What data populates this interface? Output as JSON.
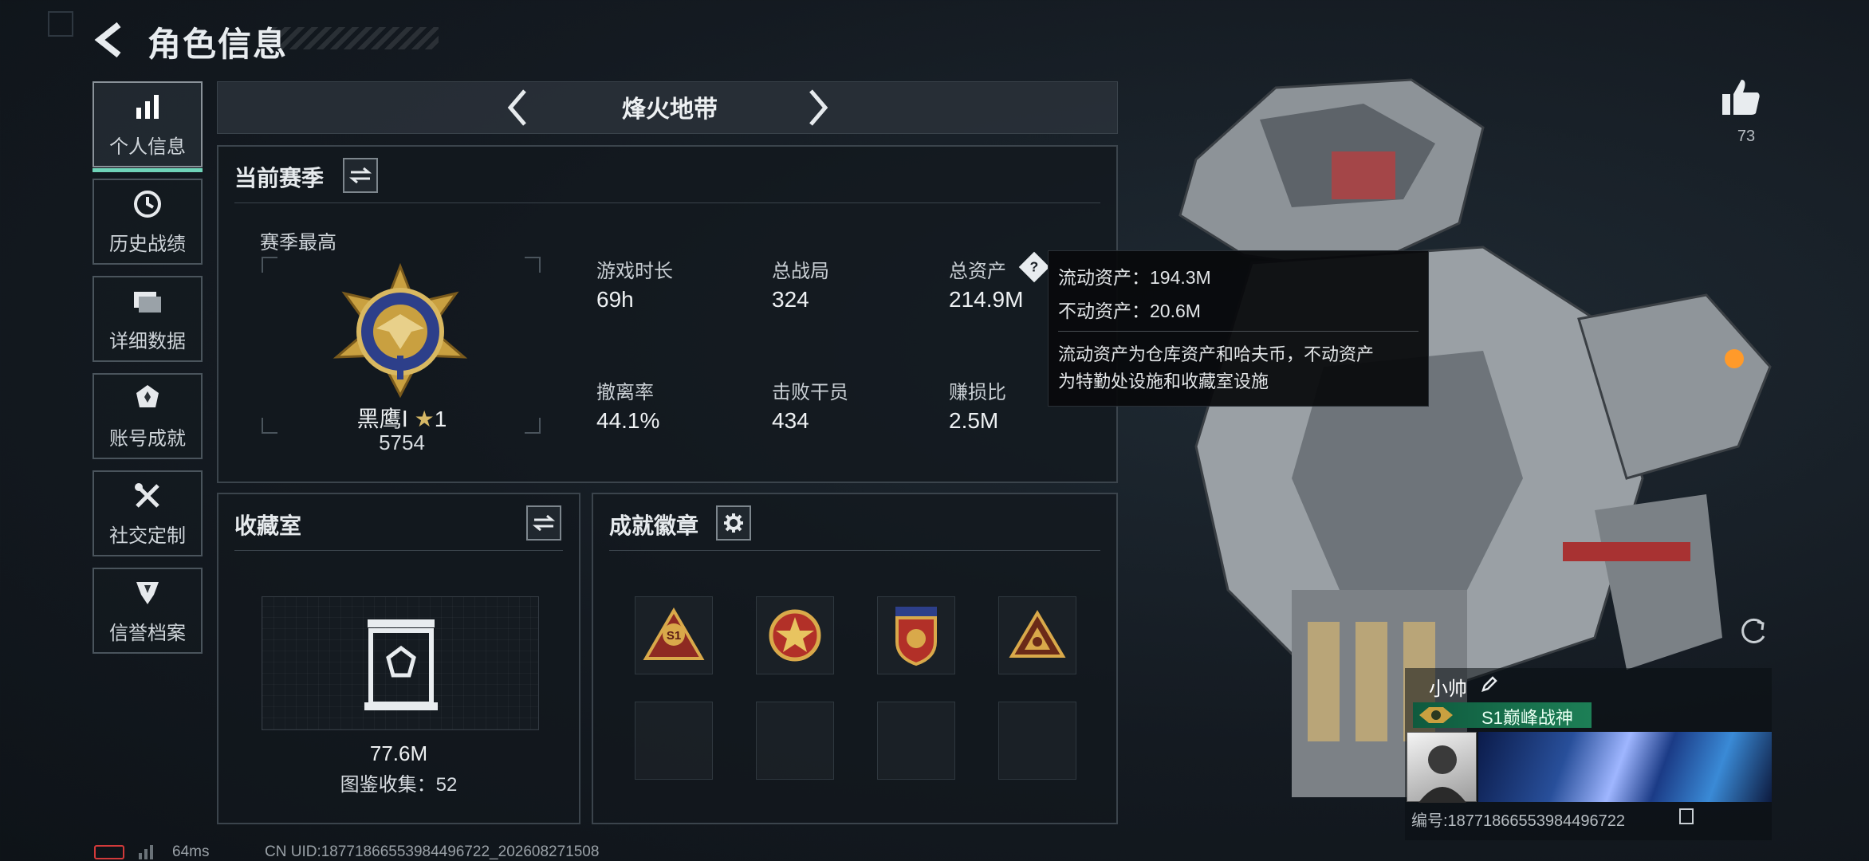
{
  "header": {
    "title": "角色信息"
  },
  "sidebar": {
    "items": [
      {
        "label": "个人信息",
        "icon": "bar-chart-icon",
        "active": true
      },
      {
        "label": "历史战绩",
        "icon": "history-icon",
        "active": false
      },
      {
        "label": "详细数据",
        "icon": "folder-icon",
        "active": false
      },
      {
        "label": "账号成就",
        "icon": "achievement-icon",
        "active": false
      },
      {
        "label": "社交定制",
        "icon": "tools-icon",
        "active": false
      },
      {
        "label": "信誉档案",
        "icon": "shield-icon",
        "active": false
      }
    ]
  },
  "mode": {
    "title": "烽火地带"
  },
  "season": {
    "panel_title": "当前赛季",
    "best_label": "赛季最高",
    "rank_name": "黑鹰Ⅰ",
    "rank_stars": "1",
    "rank_points": "5754",
    "stats": [
      {
        "label": "游戏时长",
        "value": "69h"
      },
      {
        "label": "总战局",
        "value": "324"
      },
      {
        "label": "总资产",
        "value": "214.9M"
      },
      {
        "label": "撤离率",
        "value": "44.1%"
      },
      {
        "label": "击败干员",
        "value": "434"
      },
      {
        "label": "赚损比",
        "value": "2.5M"
      }
    ]
  },
  "tooltip": {
    "liquid": "流动资产：194.3M",
    "fixed": "不动资产：20.6M",
    "desc_line1": "流动资产为仓库资产和哈夫币，不动资产",
    "desc_line2": "为特勤处设施和收藏室设施"
  },
  "collection": {
    "panel_title": "收藏室",
    "value": "77.6M",
    "catalog": "图鉴收集：52"
  },
  "badges": {
    "panel_title": "成就徽章",
    "slots": [
      "S1",
      "star-badge",
      "shield-badge",
      "triangle-badge",
      "",
      "",
      "",
      ""
    ]
  },
  "character": {
    "name": "小帅",
    "title": "S1巅峰战神",
    "uid": "编号:18771866553984496722"
  },
  "likes": {
    "count": "73"
  },
  "footer": {
    "ping": "64ms",
    "uid": "CN UID:18771866553984496722_202608271508"
  },
  "colors": {
    "accent": "#6fd3b8",
    "panel_border": "#3b444c",
    "badge_gold": "#c9a040"
  }
}
